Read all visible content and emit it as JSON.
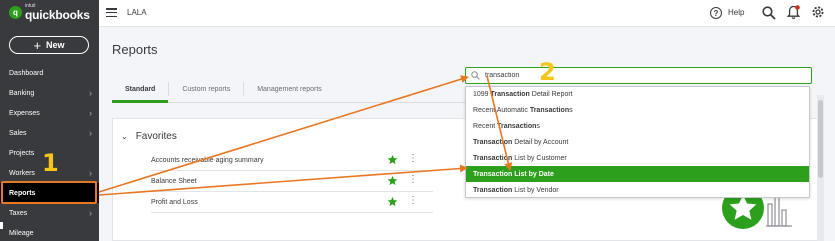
{
  "app": {
    "logo_small": "intuit",
    "logo_big": "quickbooks",
    "logo_letter": "q"
  },
  "sidebar": {
    "new_label": "New",
    "items": [
      {
        "label": "Dashboard",
        "chevron": false
      },
      {
        "label": "Banking",
        "chevron": true
      },
      {
        "label": "Expenses",
        "chevron": true
      },
      {
        "label": "Sales",
        "chevron": true
      },
      {
        "label": "Projects",
        "chevron": false
      },
      {
        "label": "Workers",
        "chevron": true
      },
      {
        "label": "Reports",
        "chevron": false,
        "active": true
      },
      {
        "label": "Taxes",
        "chevron": true
      },
      {
        "label": "Mileage",
        "chevron": false
      }
    ]
  },
  "topbar": {
    "company_name": "LALA",
    "help_label": "Help",
    "help_icon_glyph": "?"
  },
  "page": {
    "title": "Reports"
  },
  "tabs": [
    {
      "label": "Standard",
      "active": true
    },
    {
      "label": "Custom reports",
      "active": false
    },
    {
      "label": "Management reports",
      "active": false
    }
  ],
  "favorites": {
    "heading": "Favorites",
    "rows": [
      {
        "label": "Accounts receivable aging summary"
      },
      {
        "label": "Balance Sheet"
      },
      {
        "label": "Profit and Loss"
      }
    ]
  },
  "search": {
    "value": "transaction",
    "results": [
      {
        "pre": "1099 ",
        "bold": "Transaction",
        "post": " Detail Report",
        "highlighted": false
      },
      {
        "pre": "Recent Automatic ",
        "bold": "Transaction",
        "post": "s",
        "highlighted": false
      },
      {
        "pre": "Recent ",
        "bold": "Transaction",
        "post": "s",
        "highlighted": false
      },
      {
        "pre": "",
        "bold": "Transaction",
        "post": " Detail by Account",
        "highlighted": false
      },
      {
        "pre": "",
        "bold": "Transaction",
        "post": " List by Customer",
        "highlighted": false
      },
      {
        "pre": "",
        "bold": "Transaction List by Date",
        "post": "",
        "highlighted": true
      },
      {
        "pre": "",
        "bold": "Transaction",
        "post": " List by Vendor",
        "highlighted": false
      }
    ]
  },
  "annotations": {
    "step1": "1",
    "step2": "2",
    "arrow_color": "#e87722",
    "number_color": "#f5c518"
  },
  "colors": {
    "brand_green": "#2ca01c",
    "sidebar_bg": "#393a3d"
  }
}
